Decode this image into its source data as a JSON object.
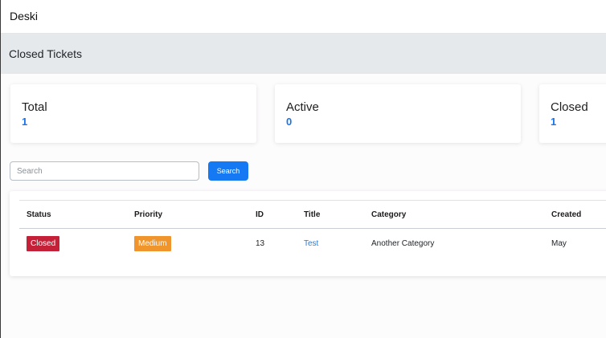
{
  "app": {
    "brand": "Deski"
  },
  "page": {
    "title": "Closed Tickets"
  },
  "stats": [
    {
      "label": "Total",
      "value": "1"
    },
    {
      "label": "Active",
      "value": "0"
    },
    {
      "label": "Closed",
      "value": "1"
    }
  ],
  "search": {
    "placeholder": "Search",
    "value": "",
    "button_label": "Search"
  },
  "table": {
    "headers": [
      "Status",
      "Priority",
      "ID",
      "Title",
      "Category",
      "Created"
    ],
    "rows": [
      {
        "status": "Closed",
        "priority": "Medium",
        "id": "13",
        "title": "Test",
        "category": "Another Category",
        "created": "May"
      }
    ]
  },
  "colors": {
    "accent": "#1479f2",
    "status_closed": "#c42038",
    "priority_medium": "#f0942c",
    "stat_value": "#1a73e8",
    "link": "#2d7ad6"
  }
}
